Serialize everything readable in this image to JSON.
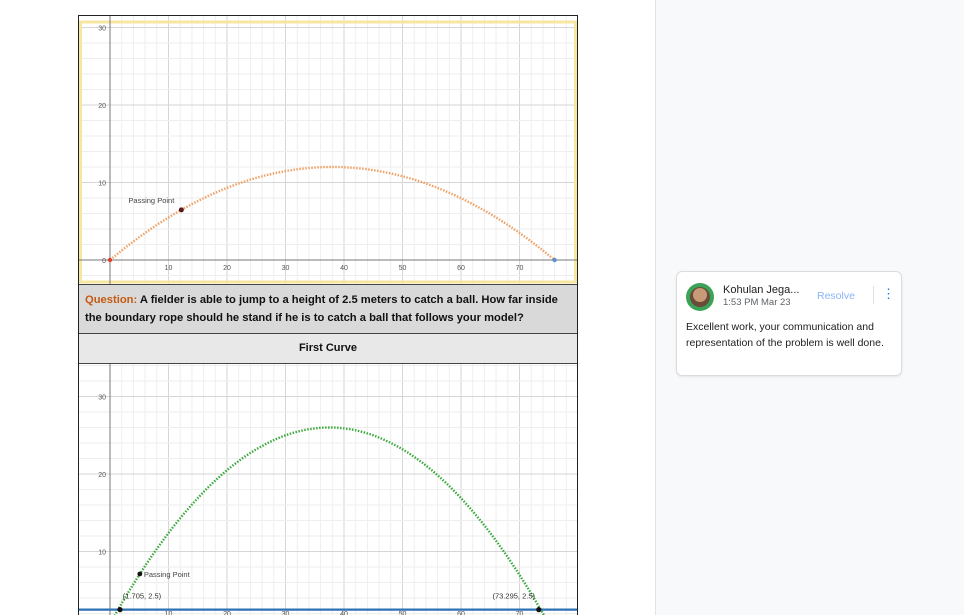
{
  "document": {
    "question_label": "Question:",
    "question_text": "A fielder is able to jump to a height of 2.5 meters to catch a ball. How far inside the boundary rope should he stand if he is to catch a ball that follows your model?",
    "first_curve_caption": "First Curve"
  },
  "graph_top": {
    "y_tick_labels": [
      "30",
      "20",
      "10",
      "0"
    ],
    "x_tick_labels": [
      "10",
      "20",
      "30",
      "40",
      "50",
      "60",
      "70"
    ],
    "point_label": "Passing Point",
    "curve_color": "#f0a064",
    "border_color": "#f5e6a0"
  },
  "graph_bottom": {
    "y_tick_labels": [
      "30",
      "20",
      "10"
    ],
    "x_tick_labels": [
      "10",
      "20",
      "30",
      "40",
      "50",
      "60",
      "70"
    ],
    "point_label": "Passing Point",
    "left_point_label": "(1.705, 2.5)",
    "right_point_label": "(73.295, 2.5)",
    "curve_color": "#3caa3c",
    "line_color": "#2d70b3"
  },
  "comment": {
    "author": "Kohulan Jega...",
    "time": "1:53 PM Mar 23",
    "resolve_label": "Resolve",
    "more_icon": "more-vert-icon",
    "body": "Excellent work, your communication and representation of the problem is well done."
  }
}
